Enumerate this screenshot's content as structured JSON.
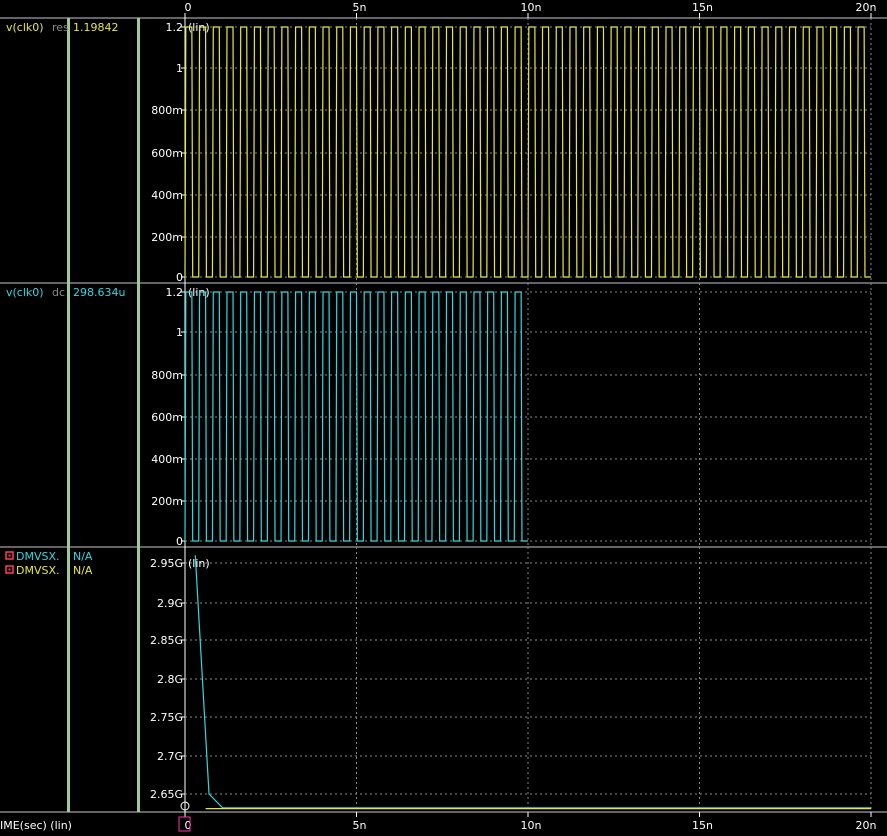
{
  "colors": {
    "background": "#000000",
    "panel_divider": "#c8c8c8",
    "column_divider": "#9ec99a",
    "grid": "#8a8a8a",
    "axis_text": "#ffffff",
    "trace_yellow": "#e6e64a",
    "trace_cyan": "#36d6e0",
    "marker_red": "#ff3b5c",
    "cursor_box": "#ff2fa8"
  },
  "x_axis": {
    "unit_label": "IME(sec) (lin)",
    "tick_labels": [
      "0",
      "5n",
      "10n",
      "15n",
      "20n"
    ],
    "cursor_value": "0"
  },
  "panels": [
    {
      "id": "panel-1",
      "signals": [
        {
          "name": "v(clk0)",
          "analysis": "res",
          "value": "1.19842",
          "color": "#e6e64a",
          "marker_icon": ""
        }
      ],
      "scale_note": "(lin)",
      "y_tick_labels": [
        "1.2",
        "1",
        "800m",
        "600m",
        "400m",
        "200m",
        "0"
      ]
    },
    {
      "id": "panel-2",
      "signals": [
        {
          "name": "v(clk0)",
          "analysis": "dc",
          "value": "298.634u",
          "color": "#36d6e0",
          "marker_icon": ""
        }
      ],
      "scale_note": "(lin)",
      "y_tick_labels": [
        "1.2",
        "1",
        "800m",
        "600m",
        "400m",
        "200m",
        "0"
      ]
    },
    {
      "id": "panel-3",
      "signals": [
        {
          "name": "DMVSX.",
          "analysis": "",
          "value": "N/A",
          "color": "#36d6e0",
          "marker_icon": "square-marker-icon"
        },
        {
          "name": "DMVSX.",
          "analysis": "",
          "value": "N/A",
          "color": "#e6e64a",
          "marker_icon": "square-marker-icon"
        }
      ],
      "scale_note": "(lin)",
      "y_tick_labels": [
        "2.95G",
        "2.9G",
        "2.85G",
        "2.8G",
        "2.75G",
        "2.7G",
        "2.65G"
      ]
    }
  ],
  "chart_data": [
    {
      "type": "line",
      "title": "",
      "xlabel": "TIME(sec) (lin)",
      "ylabel": "",
      "xlim": [
        0,
        2e-08
      ],
      "ylim": [
        0,
        1.2
      ],
      "grid": true,
      "series": [
        {
          "name": "v(clk0) res",
          "shape": "square-wave",
          "period": 4e-10,
          "low": 0,
          "high": 1.2,
          "x_range": [
            0,
            2e-08
          ]
        }
      ]
    },
    {
      "type": "line",
      "title": "",
      "xlabel": "TIME(sec) (lin)",
      "ylabel": "",
      "xlim": [
        0,
        2e-08
      ],
      "ylim": [
        0,
        1.2
      ],
      "grid": true,
      "series": [
        {
          "name": "v(clk0) dc",
          "shape": "square-wave",
          "period": 4e-10,
          "low": 0,
          "high": 1.2,
          "x_range": [
            0,
            1e-08
          ]
        }
      ]
    },
    {
      "type": "line",
      "title": "",
      "xlabel": "TIME(sec) (lin)",
      "ylabel": "",
      "xlim": [
        0,
        2e-08
      ],
      "ylim": [
        2630000000.0,
        2960000000.0
      ],
      "grid": true,
      "series": [
        {
          "name": "DMVSX. (cyan)",
          "x": [
            3e-10,
            7e-10,
            1.1e-09,
            2e-08
          ],
          "y": [
            2960000000.0,
            2650000000.0,
            2632000000.0,
            2632000000.0
          ]
        },
        {
          "name": "DMVSX. (yellow)",
          "x": [
            6e-10,
            2e-08
          ],
          "y": [
            2631000000.0,
            2631000000.0
          ]
        }
      ]
    }
  ]
}
